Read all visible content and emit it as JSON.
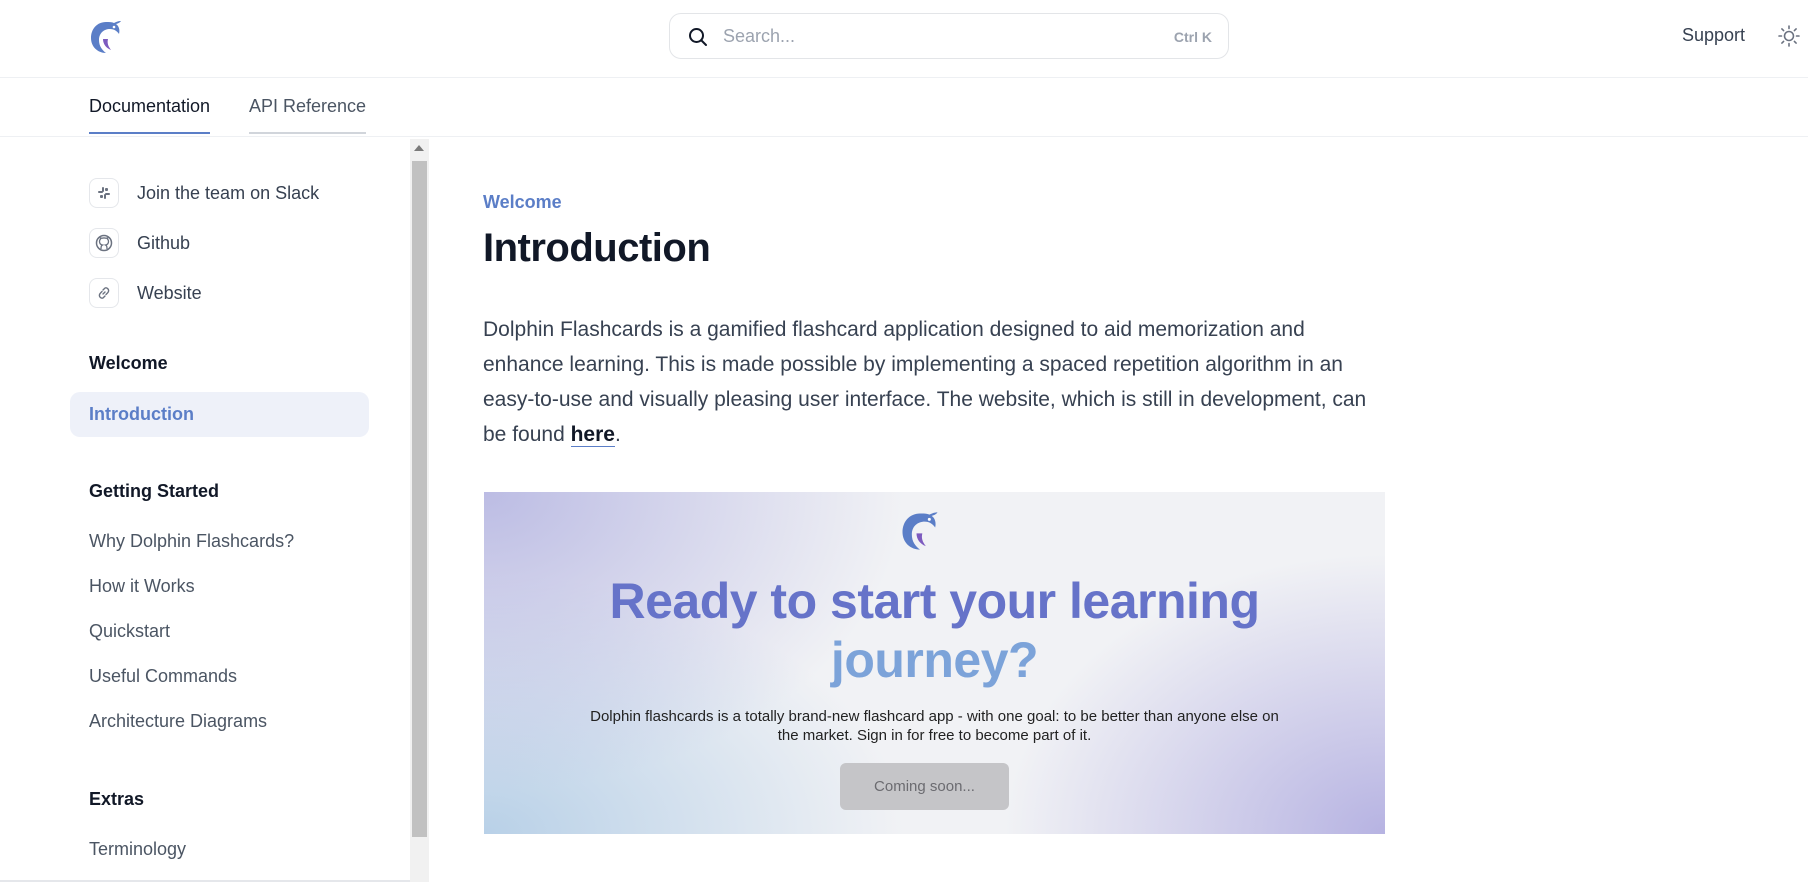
{
  "header": {
    "search_placeholder": "Search...",
    "search_shortcut": "Ctrl K",
    "support_label": "Support"
  },
  "tabs": [
    {
      "label": "Documentation",
      "active": true
    },
    {
      "label": "API Reference",
      "active": false
    }
  ],
  "sidebar": {
    "links": [
      {
        "icon": "slack-icon",
        "label": "Join the team on Slack"
      },
      {
        "icon": "github-icon",
        "label": "Github"
      },
      {
        "icon": "link-icon",
        "label": "Website"
      }
    ],
    "sections": [
      {
        "title": "Welcome",
        "items": [
          "Introduction"
        ]
      },
      {
        "title": "Getting Started",
        "items": [
          "Why Dolphin Flashcards?",
          "How it Works",
          "Quickstart",
          "Useful Commands",
          "Architecture Diagrams"
        ]
      },
      {
        "title": "Extras",
        "items": [
          "Terminology"
        ]
      }
    ],
    "active_item": "Introduction"
  },
  "main": {
    "breadcrumb": "Welcome",
    "title": "Introduction",
    "intro_text": "Dolphin Flashcards is a gamified flashcard application designed to aid memorization and enhance learning. This is made possible by implementing a spaced repetition algorithm in an easy-to-use and visually pleasing user interface. The website, which is still in development, can be found ",
    "intro_link": "here",
    "intro_end": "."
  },
  "hero": {
    "title_line1": "Ready to start your learning",
    "title_line2": "journey?",
    "subtitle": "Dolphin flashcards is a totally brand-new flashcard app - with one goal: to be better than anyone else on the market. Sign in for free to become part of it.",
    "button_label": "Coming soon..."
  },
  "colors": {
    "accent": "#5b7ec7",
    "hero_title_primary": "#6673c9",
    "hero_title_secondary": "#7ca3d9"
  }
}
